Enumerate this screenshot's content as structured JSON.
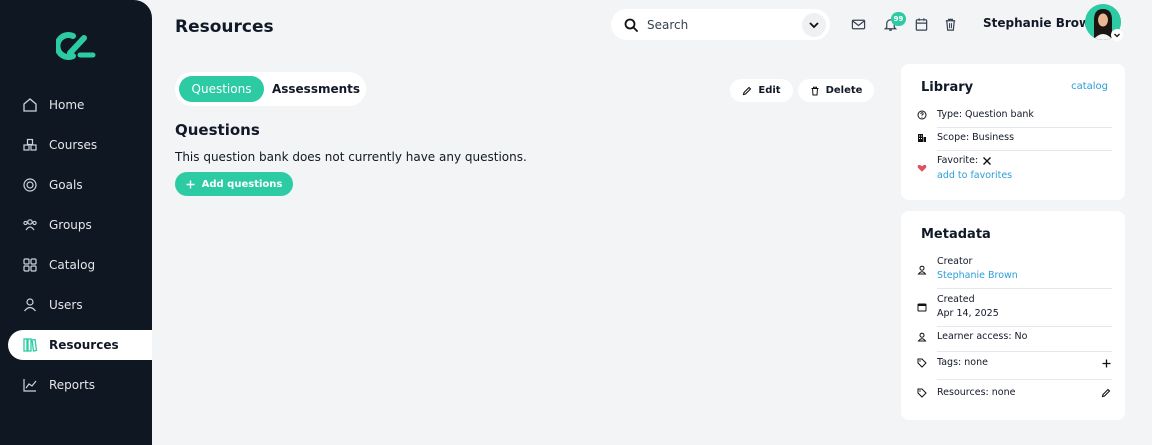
{
  "sidebar": {
    "items": [
      {
        "label": "Home",
        "icon": "home-icon"
      },
      {
        "label": "Courses",
        "icon": "courses-icon"
      },
      {
        "label": "Goals",
        "icon": "goals-icon"
      },
      {
        "label": "Groups",
        "icon": "groups-icon"
      },
      {
        "label": "Catalog",
        "icon": "catalog-icon"
      },
      {
        "label": "Users",
        "icon": "users-icon"
      },
      {
        "label": "Resources",
        "icon": "resources-icon"
      },
      {
        "label": "Reports",
        "icon": "reports-icon"
      }
    ],
    "active": "Resources"
  },
  "header": {
    "title": "Resources",
    "search_placeholder": "Search",
    "notification_count": "99",
    "user_name": "Stephanie Brown"
  },
  "tabs": [
    {
      "label": "Questions",
      "active": true
    },
    {
      "label": "Assessments",
      "active": false
    }
  ],
  "actions": {
    "edit": "Edit",
    "delete": "Delete"
  },
  "main": {
    "section_title": "Questions",
    "empty_message": "This question bank does not currently have any questions.",
    "add_button": "Add questions"
  },
  "library": {
    "title": "Library",
    "link": "catalog",
    "type": "Type: Question bank",
    "scope": "Scope: Business",
    "favorite_label": "Favorite:",
    "favorite_link": "add to favorites"
  },
  "metadata": {
    "title": "Metadata",
    "creator_label": "Creator",
    "creator_value": "Stephanie Brown",
    "created_label": "Created",
    "created_value": "Apr 14, 2025",
    "learner_access": "Learner access: No",
    "tags": "Tags: none",
    "resources": "Resources: none"
  },
  "colors": {
    "accent": "#2ccba3",
    "sidebar_bg": "#0f1722",
    "link": "#2a9fd6",
    "heart": "#e0505e"
  }
}
